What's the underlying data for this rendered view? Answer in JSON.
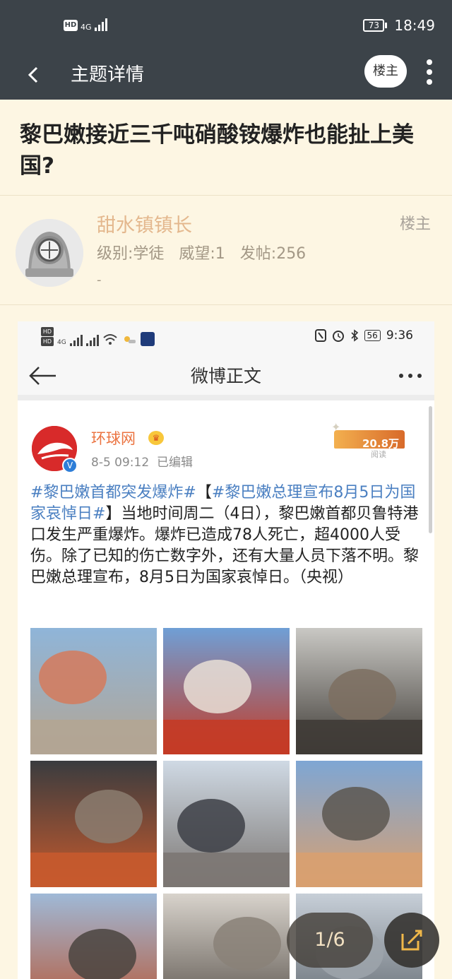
{
  "status_bar": {
    "hd": "HD",
    "network": "4G",
    "battery": "73",
    "time": "18:49"
  },
  "appbar": {
    "title": "主题详情",
    "louzhu_button": "楼主"
  },
  "thread": {
    "title": "黎巴嫩接近三千吨硝酸铵爆炸也能扯上美国?"
  },
  "author": {
    "name": "甜水镇镇长",
    "level": "级别:学徒   威望:1   发帖:256",
    "extra": "-",
    "role": "楼主"
  },
  "embedded": {
    "status_bar": {
      "hd1": "HD",
      "hd2": "HD",
      "net": "4G",
      "battery": "56",
      "time": "9:36"
    },
    "nav_title": "微博正文",
    "poster": {
      "name": "环球网",
      "time": "8-5 09:12  已编辑",
      "read_count": "20.8万",
      "read_label": "阅读"
    },
    "post": {
      "tag1": "#黎巴嫩首都突发爆炸#",
      "bracket_open": "【",
      "tag2": "#黎巴嫩总理宣布8月5日为国家哀悼日#",
      "body": "】当地时间周二（4日），黎巴嫩首都贝鲁特港口发生严重爆炸。爆炸已造成78人死亡，超4000人受伤。除了已知的伤亡数字外，还有大量人员下落不明。黎巴嫩总理宣布，8月5日为国家哀悼日。（央视）"
    },
    "images": [
      {
        "name": "mushroom-cloud-photo",
        "palette": [
          "#8fb5d9",
          "#d57a5c",
          "#b3a594"
        ]
      },
      {
        "name": "shockwave-dome-photo",
        "palette": [
          "#6f9fd6",
          "#e9dfd6",
          "#c43b26"
        ]
      },
      {
        "name": "street-aerial-photo",
        "palette": [
          "#c9c8c4",
          "#7c6e60",
          "#3f3b36"
        ]
      },
      {
        "name": "firefighters-photo",
        "palette": [
          "#3a3c3f",
          "#8b7c70",
          "#c65a2d"
        ]
      },
      {
        "name": "smoke-plume-photo",
        "palette": [
          "#cfd9e4",
          "#3d4046",
          "#7c7773"
        ]
      },
      {
        "name": "harbor-smoke-photo",
        "palette": [
          "#7ea6d4",
          "#5c5750",
          "#d8a070"
        ]
      },
      {
        "name": "ruins-fire-photo",
        "palette": [
          "#9fb9d7",
          "#4a4440",
          "#b9532f"
        ]
      },
      {
        "name": "damaged-street-photo",
        "palette": [
          "#d8d3cc",
          "#8a8178",
          "#544d46"
        ]
      },
      {
        "name": "city-haze-photo",
        "palette": [
          "#c7cfd8",
          "#9ea4ab",
          "#5e656c"
        ]
      }
    ]
  },
  "pager": "1/6"
}
